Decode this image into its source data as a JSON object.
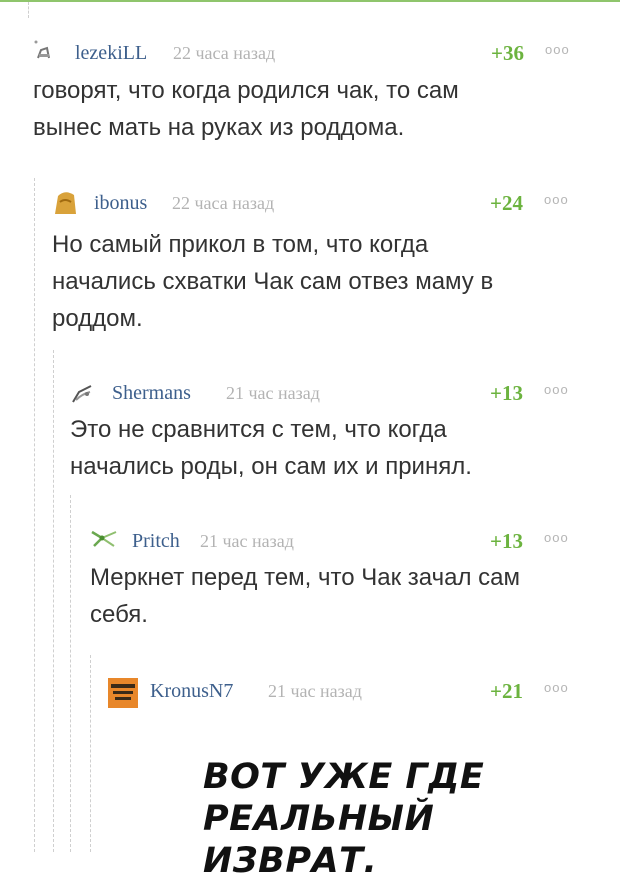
{
  "comments": [
    {
      "author": "lezekiLL",
      "time": "22 часа назад",
      "rating": "+36",
      "more": "ooo",
      "text": "говорят, что когда родился чак, то сам\nвынес мать на руках из роддома."
    },
    {
      "author": "ibonus",
      "time": "22 часа назад",
      "rating": "+24",
      "more": "ooo",
      "text": "Но самый прикол в том, что когда\nначались схватки Чак сам отвез маму в\nроддом."
    },
    {
      "author": "Shermans",
      "time": "21 час назад",
      "rating": "+13",
      "more": "ooo",
      "text": "Это не сравнится с тем, что когда\nначались роды, он сам их и принял."
    },
    {
      "author": "Pritch",
      "time": "21 час назад",
      "rating": "+13",
      "more": "ooo",
      "text": "Меркнет перед тем, что Чак зачал сам\nсебя."
    },
    {
      "author": "KronusN7",
      "time": "21 час назад",
      "rating": "+21",
      "more": "ooo",
      "meme_text": "ВОТ УЖЕ ГДЕ\nРЕАЛЬНЫЙ ИЗВРАТ."
    }
  ],
  "colors": {
    "accent_green": "#6cb33f",
    "author_blue": "#3d5f8c",
    "muted": "#b3b3b3"
  }
}
